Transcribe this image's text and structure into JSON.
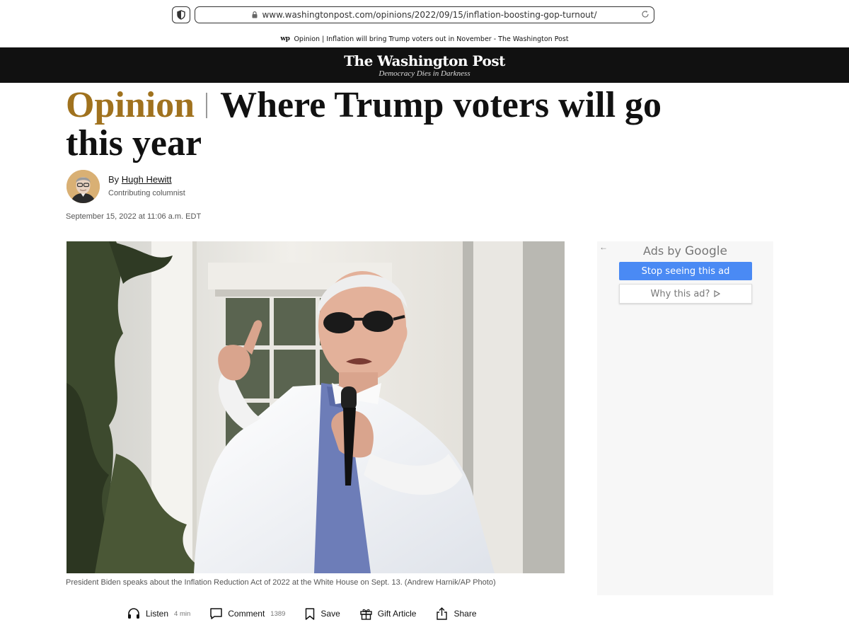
{
  "browser": {
    "url": "www.washingtonpost.com/opinions/2022/09/15/inflation-boosting-gop-turnout/",
    "tab_favicon": "wp",
    "tab_title": "Opinion | Inflation will bring Trump voters out in November - The Washington Post"
  },
  "masthead": {
    "logo": "The Washington Post",
    "tagline": "Democracy Dies in Darkness",
    "background": "#111111"
  },
  "article": {
    "kicker": "Opinion",
    "kicker_color": "#a0721e",
    "headline": "Where Trump voters will go this year",
    "byline_prefix": "By",
    "author": "Hugh Hewitt",
    "author_role": "Contributing columnist",
    "dateline": "September 15, 2022 at 11:06 a.m. EDT",
    "caption": "President Biden speaks about the Inflation Reduction Act of 2022 at the White House on Sept. 13. (Andrew Harnik/AP Photo)"
  },
  "ad": {
    "ads_by": "Ads by",
    "brand": "Google",
    "stop_label": "Stop seeing this ad",
    "why_label": "Why this ad?",
    "why_icon": "play-outline-icon",
    "stop_color": "#4a8af4"
  },
  "actions": [
    {
      "label": "Listen",
      "count": "4 min",
      "icon": "headphones-icon"
    },
    {
      "label": "Comment",
      "count": "1389",
      "icon": "comment-icon"
    },
    {
      "label": "Save",
      "count": "",
      "icon": "bookmark-icon"
    },
    {
      "label": "Gift Article",
      "count": "",
      "icon": "gift-icon"
    },
    {
      "label": "Share",
      "count": "",
      "icon": "share-icon"
    }
  ]
}
